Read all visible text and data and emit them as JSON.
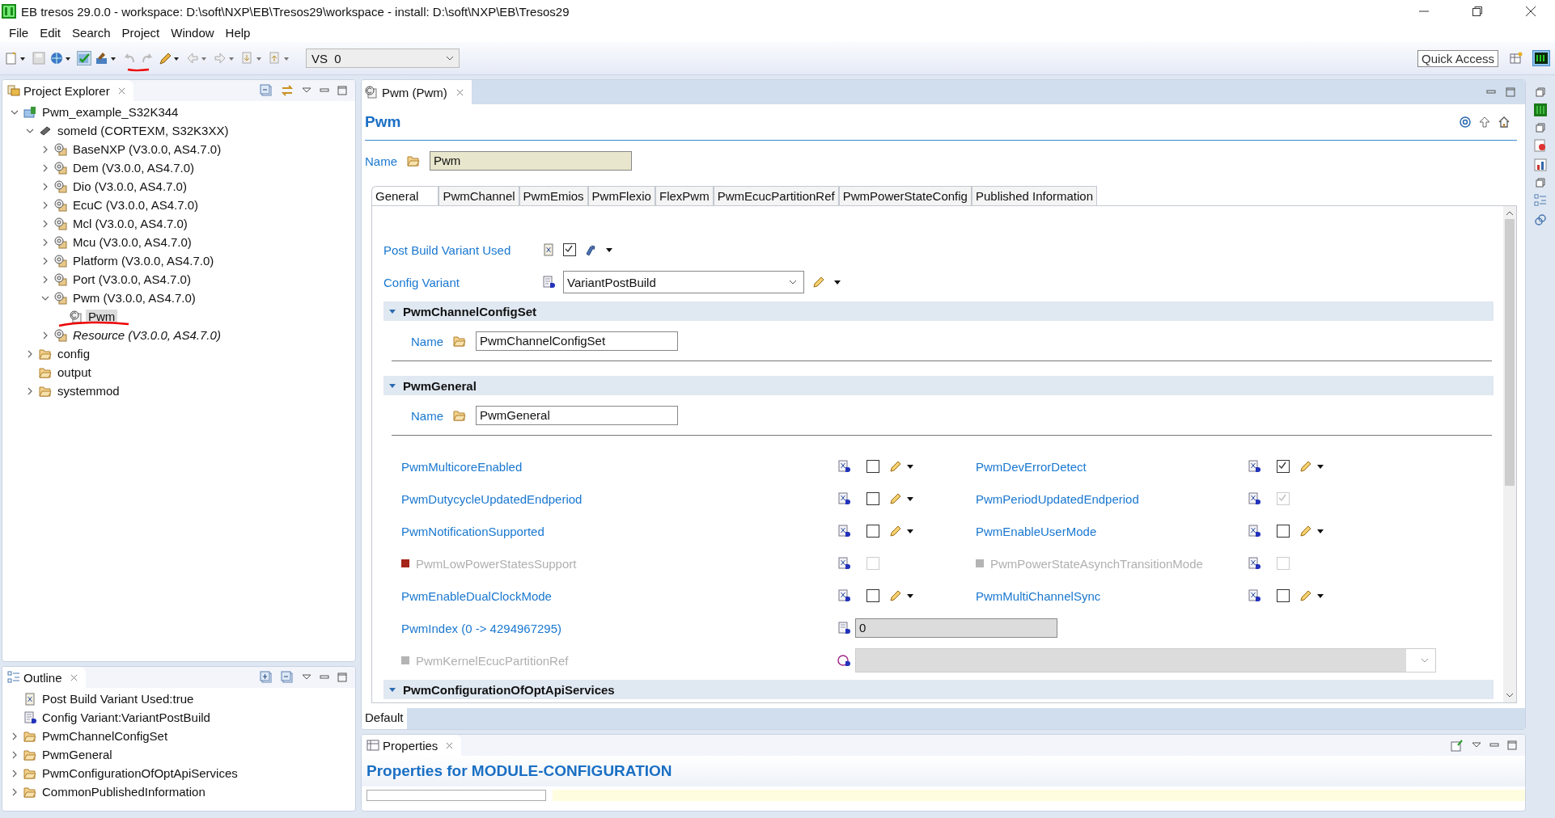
{
  "window": {
    "title": "EB tresos 29.0.0 - workspace: D:\\soft\\NXP\\EB\\Tresos29\\workspace - install: D:\\soft\\NXP\\EB\\Tresos29"
  },
  "menu": [
    "File",
    "Edit",
    "Search",
    "Project",
    "Window",
    "Help"
  ],
  "toolbar": {
    "variant": "VS  0",
    "quick_access": "Quick Access"
  },
  "project_explorer": {
    "title": "Project Explorer",
    "tree": [
      {
        "label": "Pwm_example_S32K344",
        "kind": "project",
        "expanded": true,
        "selected": false,
        "italic": false,
        "children": [
          {
            "label": "someId (CORTEXM, S32K3XX)",
            "kind": "ecu",
            "expanded": true,
            "selected": false,
            "italic": false,
            "children": [
              {
                "label": "BaseNXP (V3.0.0, AS4.7.0)",
                "kind": "module",
                "expanded": false,
                "selected": false,
                "italic": false
              },
              {
                "label": "Dem (V3.0.0, AS4.7.0)",
                "kind": "module",
                "expanded": false,
                "selected": false,
                "italic": false
              },
              {
                "label": "Dio (V3.0.0, AS4.7.0)",
                "kind": "module",
                "expanded": false,
                "selected": false,
                "italic": false
              },
              {
                "label": "EcuC (V3.0.0, AS4.7.0)",
                "kind": "module",
                "expanded": false,
                "selected": false,
                "italic": false
              },
              {
                "label": "Mcl (V3.0.0, AS4.7.0)",
                "kind": "module",
                "expanded": false,
                "selected": false,
                "italic": false
              },
              {
                "label": "Mcu (V3.0.0, AS4.7.0)",
                "kind": "module",
                "expanded": false,
                "selected": false,
                "italic": false
              },
              {
                "label": "Platform (V3.0.0, AS4.7.0)",
                "kind": "module",
                "expanded": false,
                "selected": false,
                "italic": false
              },
              {
                "label": "Port (V3.0.0, AS4.7.0)",
                "kind": "module",
                "expanded": false,
                "selected": false,
                "italic": false
              },
              {
                "label": "Pwm (V3.0.0, AS4.7.0)",
                "kind": "module",
                "expanded": true,
                "selected": false,
                "italic": false,
                "children": [
                  {
                    "label": "Pwm",
                    "kind": "config",
                    "selected": true,
                    "italic": false
                  }
                ]
              },
              {
                "label": "Resource (V3.0.0, AS4.7.0)",
                "kind": "module",
                "expanded": false,
                "selected": false,
                "italic": true
              }
            ]
          },
          {
            "label": "config",
            "kind": "folder",
            "expanded": false,
            "selected": false,
            "italic": false
          },
          {
            "label": "output",
            "kind": "folder",
            "selected": false,
            "italic": false
          },
          {
            "label": "systemmod",
            "kind": "folder",
            "expanded": false,
            "selected": false,
            "italic": false
          }
        ]
      }
    ]
  },
  "outline": {
    "title": "Outline",
    "items": [
      {
        "label": "Post Build Variant Used:true",
        "kind": "boolean"
      },
      {
        "label": "Config Variant:VariantPostBuild",
        "kind": "enum"
      },
      {
        "label": "PwmChannelConfigSet",
        "kind": "container",
        "expanded": false
      },
      {
        "label": "PwmGeneral",
        "kind": "container",
        "expanded": false
      },
      {
        "label": "PwmConfigurationOfOptApiServices",
        "kind": "container",
        "expanded": false
      },
      {
        "label": "CommonPublishedInformation",
        "kind": "container",
        "expanded": false
      }
    ]
  },
  "editor": {
    "tab": "Pwm (Pwm)",
    "heading": "Pwm",
    "name_label": "Name",
    "name_value": "Pwm",
    "tabs": [
      {
        "label": "General",
        "selected": true
      },
      {
        "label": "PwmChannel",
        "selected": false
      },
      {
        "label": "PwmEmios",
        "selected": false
      },
      {
        "label": "PwmFlexio",
        "selected": false
      },
      {
        "label": "FlexPwm",
        "selected": false
      },
      {
        "label": "PwmEcucPartitionRef",
        "selected": false
      },
      {
        "label": "PwmPowerStateConfig",
        "selected": false
      },
      {
        "label": "Published Information",
        "selected": false
      }
    ],
    "post_build": {
      "label": "Post Build Variant Used",
      "checked": true
    },
    "config_variant": {
      "label": "Config Variant",
      "value": "VariantPostBuild"
    },
    "sections": [
      {
        "title": "PwmChannelConfigSet",
        "expanded": true,
        "name_label": "Name",
        "name_value": "PwmChannelConfigSet"
      },
      {
        "title": "PwmGeneral",
        "expanded": true,
        "name_label": "Name",
        "name_value": "PwmGeneral",
        "params": [
          {
            "label": "PwmMulticoreEnabled",
            "checked": false,
            "enabled": true,
            "editable": true
          },
          {
            "label": "PwmDevErrorDetect",
            "checked": true,
            "enabled": true,
            "editable": true
          },
          {
            "label": "PwmDutycycleUpdatedEndperiod",
            "checked": false,
            "enabled": true,
            "editable": true
          },
          {
            "label": "PwmPeriodUpdatedEndperiod",
            "checked": true,
            "enabled": true,
            "editable": false
          },
          {
            "label": "PwmNotificationSupported",
            "checked": false,
            "enabled": true,
            "editable": true
          },
          {
            "label": "PwmEnableUserMode",
            "checked": false,
            "enabled": true,
            "editable": true
          },
          {
            "label": "PwmLowPowerStatesSupport",
            "checked": false,
            "enabled": false,
            "editable": false,
            "color": "#a5251a"
          },
          {
            "label": "PwmPowerStateAsynchTransitionMode",
            "checked": false,
            "enabled": false,
            "editable": false,
            "color": "#b4b4b4"
          },
          {
            "label": "PwmEnableDualClockMode",
            "checked": false,
            "enabled": true,
            "editable": true
          },
          {
            "label": "PwmMultiChannelSync",
            "checked": false,
            "enabled": true,
            "editable": true
          }
        ],
        "fields": [
          {
            "label": "PwmIndex (0 -> 4294967295)",
            "kind": "number",
            "value": "0",
            "enabled": true
          },
          {
            "label": "PwmKernelEcucPartitionRef",
            "kind": "reference",
            "enabled": false,
            "color": "#b4b4b4"
          }
        ]
      },
      {
        "title": "PwmConfigurationOfOptApiServices",
        "expanded": true
      }
    ],
    "variant_tab": "Default"
  },
  "properties": {
    "title": "Properties",
    "heading": "Properties for MODULE-CONFIGURATION"
  }
}
